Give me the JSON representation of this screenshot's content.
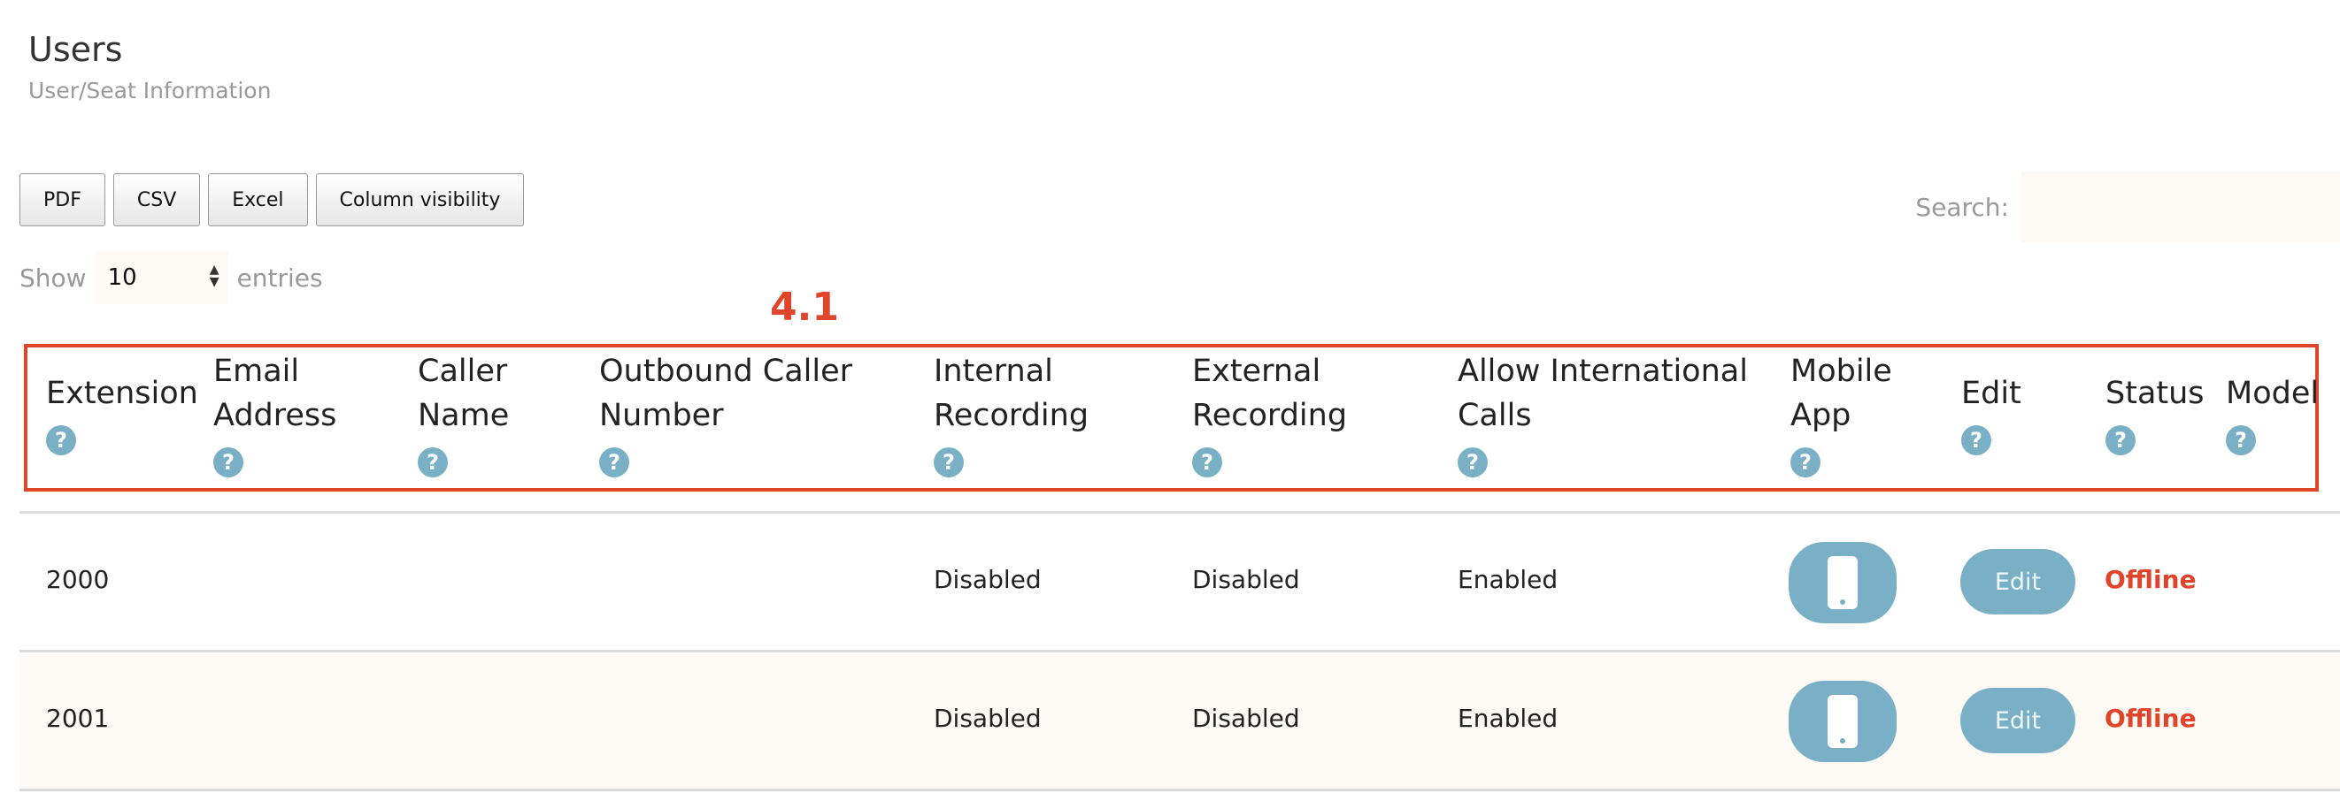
{
  "page": {
    "title": "Users",
    "subtitle": "User/Seat Information"
  },
  "toolbar": {
    "buttons": [
      "PDF",
      "CSV",
      "Excel",
      "Column visibility"
    ],
    "search_label": "Search:",
    "search_value": "",
    "length_show": "Show",
    "length_value": "10",
    "length_entries": "entries"
  },
  "annotation": {
    "label": "4.1",
    "color": "#e0452b"
  },
  "table": {
    "columns": [
      {
        "label": "Extension"
      },
      {
        "label": "Email Address"
      },
      {
        "label": "Caller Name"
      },
      {
        "label": "Outbound Caller Number"
      },
      {
        "label": "Internal Recording"
      },
      {
        "label": "External Recording"
      },
      {
        "label": "Allow International Calls"
      },
      {
        "label": "Mobile App"
      },
      {
        "label": "Edit"
      },
      {
        "label": "Status"
      },
      {
        "label": "Model"
      }
    ],
    "rows": [
      {
        "extension": "2000",
        "email": "",
        "caller_name": "",
        "outbound_number": "",
        "internal_recording": "Disabled",
        "external_recording": "Disabled",
        "international": "Enabled",
        "mobile_icon": "mobile-phone-icon",
        "edit_label": "Edit",
        "status": "Offline",
        "model": ""
      },
      {
        "extension": "2001",
        "email": "",
        "caller_name": "",
        "outbound_number": "",
        "internal_recording": "Disabled",
        "external_recording": "Disabled",
        "international": "Enabled",
        "mobile_icon": "mobile-phone-icon",
        "edit_label": "Edit",
        "status": "Offline",
        "model": ""
      }
    ]
  },
  "colors": {
    "accent": "#7ab0c6",
    "status_offline": "#e0452b",
    "row_alt": "#fdf9f4"
  }
}
